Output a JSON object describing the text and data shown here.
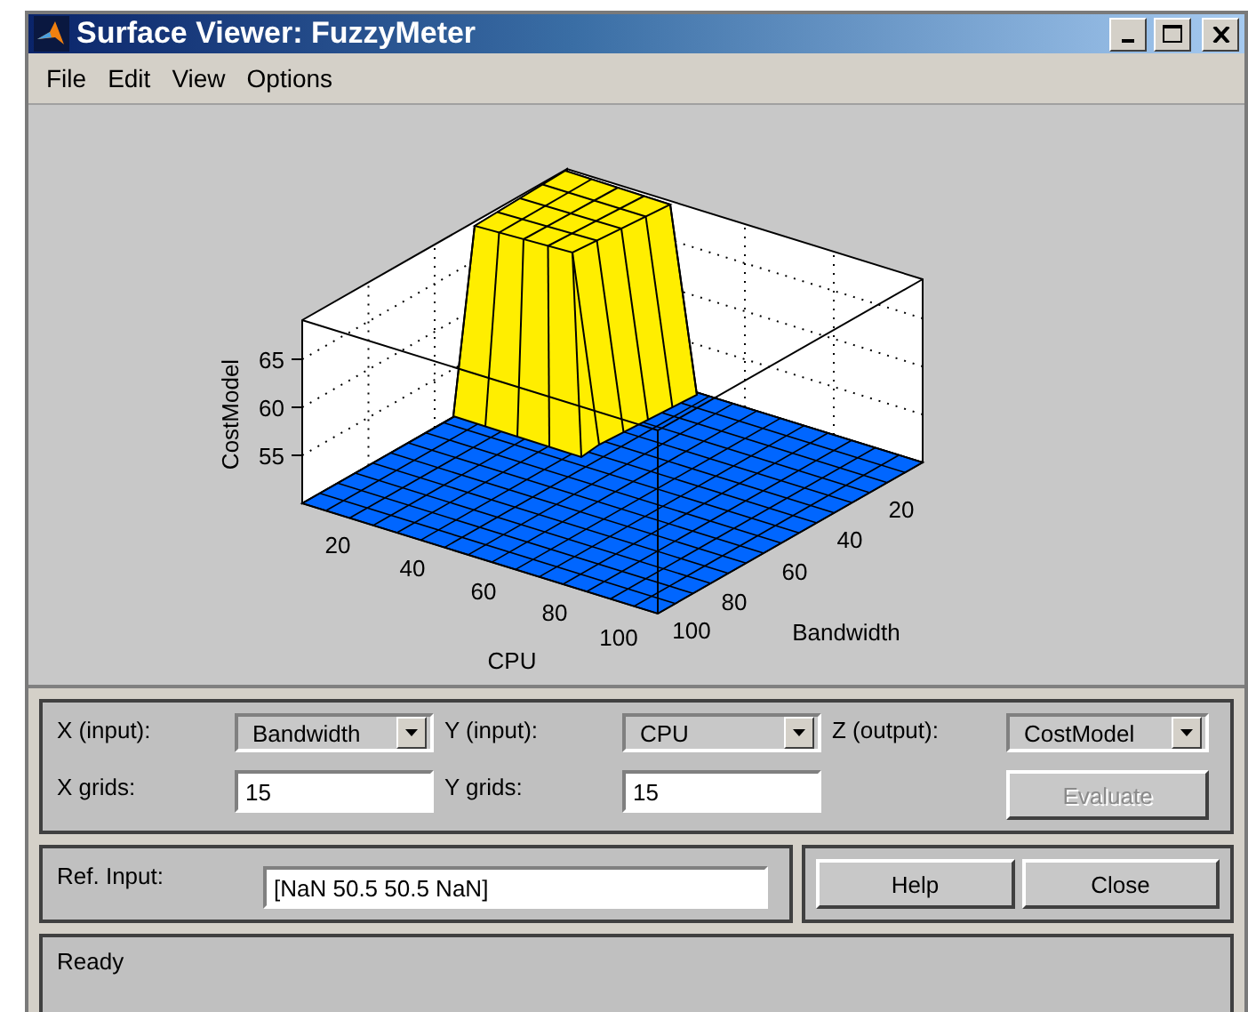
{
  "window": {
    "title": "Surface Viewer: FuzzyMeter"
  },
  "menu": [
    "File",
    "Edit",
    "View",
    "Options"
  ],
  "plot": {
    "zlabel": "CostModel",
    "xlabel": "CPU",
    "ylabel": "Bandwidth",
    "zticks": [
      "65",
      "60",
      "55"
    ],
    "xticks": [
      "20",
      "40",
      "60",
      "80",
      "100"
    ],
    "yticks": [
      "20",
      "40",
      "60",
      "80",
      "100"
    ]
  },
  "axes_panel": {
    "fields": [
      {
        "kind": "dropdown",
        "label": "X (input):",
        "value": "Bandwidth"
      },
      {
        "kind": "dropdown",
        "label": "Y (input):",
        "value": "CPU"
      },
      {
        "kind": "dropdown",
        "label": "Z (output):",
        "value": "CostModel"
      },
      {
        "kind": "text",
        "label": "X grids:",
        "value": "15"
      },
      {
        "kind": "text",
        "label": "Y grids:",
        "value": "15"
      },
      {
        "kind": "button",
        "label": "Evaluate",
        "disabled": true
      }
    ]
  },
  "ref_input": {
    "label": "Ref. Input:",
    "value": "[NaN 50.5 50.5 NaN]"
  },
  "buttons": [
    {
      "label": "Help",
      "disabled": false
    },
    {
      "label": "Close",
      "disabled": false
    }
  ],
  "status_bar": "Ready"
}
